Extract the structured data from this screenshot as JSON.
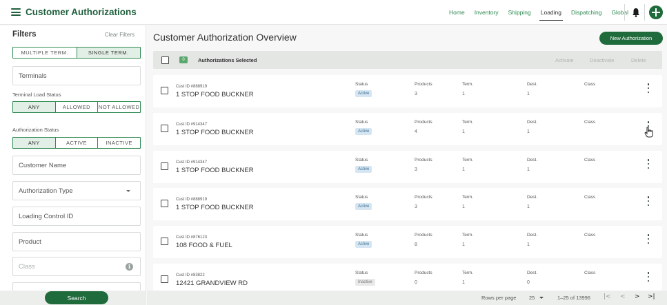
{
  "header": {
    "title": "Customer Authorizations",
    "nav": [
      "Home",
      "Inventory",
      "Shipping",
      "Loading",
      "Dispatching",
      "Global"
    ],
    "active_nav": "Loading",
    "accent_color": "#1f6b3c"
  },
  "filters": {
    "title": "Filters",
    "clear_label": "Clear Filters",
    "term_toggle": [
      "MULTIPLE TERM.",
      "SINGLE TERM."
    ],
    "term_selected": "SINGLE TERM.",
    "terminals_placeholder": "Terminals",
    "load_status_label": "Terminal Load Status",
    "load_status_options": [
      "ANY",
      "ALLOWED",
      "NOT ALLOWED"
    ],
    "load_status_selected": "ANY",
    "auth_status_label": "Authorization Status",
    "auth_status_options": [
      "ANY",
      "ACTIVE",
      "INACTIVE"
    ],
    "auth_status_selected": "ANY",
    "customer_name_placeholder": "Customer Name",
    "auth_type_placeholder": "Authorization Type",
    "loading_control_placeholder": "Loading Control ID",
    "product_placeholder": "Product",
    "class_placeholder": "Class",
    "search_label": "Search"
  },
  "main": {
    "title": "Customer Authorization Overview",
    "new_button": "New Authorization",
    "selected_count": "0",
    "selected_label": "Authorizations Selected",
    "bulk_actions": [
      "Activate",
      "Deactivate",
      "Delete"
    ],
    "columns": [
      "Status",
      "Products",
      "Term.",
      "Dest.",
      "Class"
    ],
    "rows": [
      {
        "cust_id": "Cust ID #888919",
        "name": "1 STOP FOOD BUCKNER",
        "status": "Active",
        "products": "3",
        "term": "1",
        "dest": "1",
        "class": ""
      },
      {
        "cust_id": "Cust ID #914347",
        "name": "1 STOP FOOD BUCKNER",
        "status": "Active",
        "products": "4",
        "term": "1",
        "dest": "1",
        "class": ""
      },
      {
        "cust_id": "Cust ID #914347",
        "name": "1 STOP FOOD BUCKNER",
        "status": "Active",
        "products": "3",
        "term": "1",
        "dest": "1",
        "class": ""
      },
      {
        "cust_id": "Cust ID #888919",
        "name": "1 STOP FOOD BUCKNER",
        "status": "Active",
        "products": "3",
        "term": "1",
        "dest": "1",
        "class": ""
      },
      {
        "cust_id": "Cust ID #876123",
        "name": "108 FOOD & FUEL",
        "status": "Active",
        "products": "8",
        "term": "1",
        "dest": "1",
        "class": ""
      },
      {
        "cust_id": "Cust ID #83822",
        "name": "12421 GRANDVIEW RD",
        "status": "Inactive",
        "products": "0",
        "term": "1",
        "dest": "0",
        "class": ""
      }
    ]
  },
  "pagination": {
    "rows_per_page_label": "Rows per page",
    "rows_per_page": "25",
    "range": "1–25 of 13996",
    "first_icon": "first-page-icon",
    "prev_icon": "prev-page-icon",
    "next_icon": "next-page-icon",
    "last_icon": "last-page-icon"
  }
}
